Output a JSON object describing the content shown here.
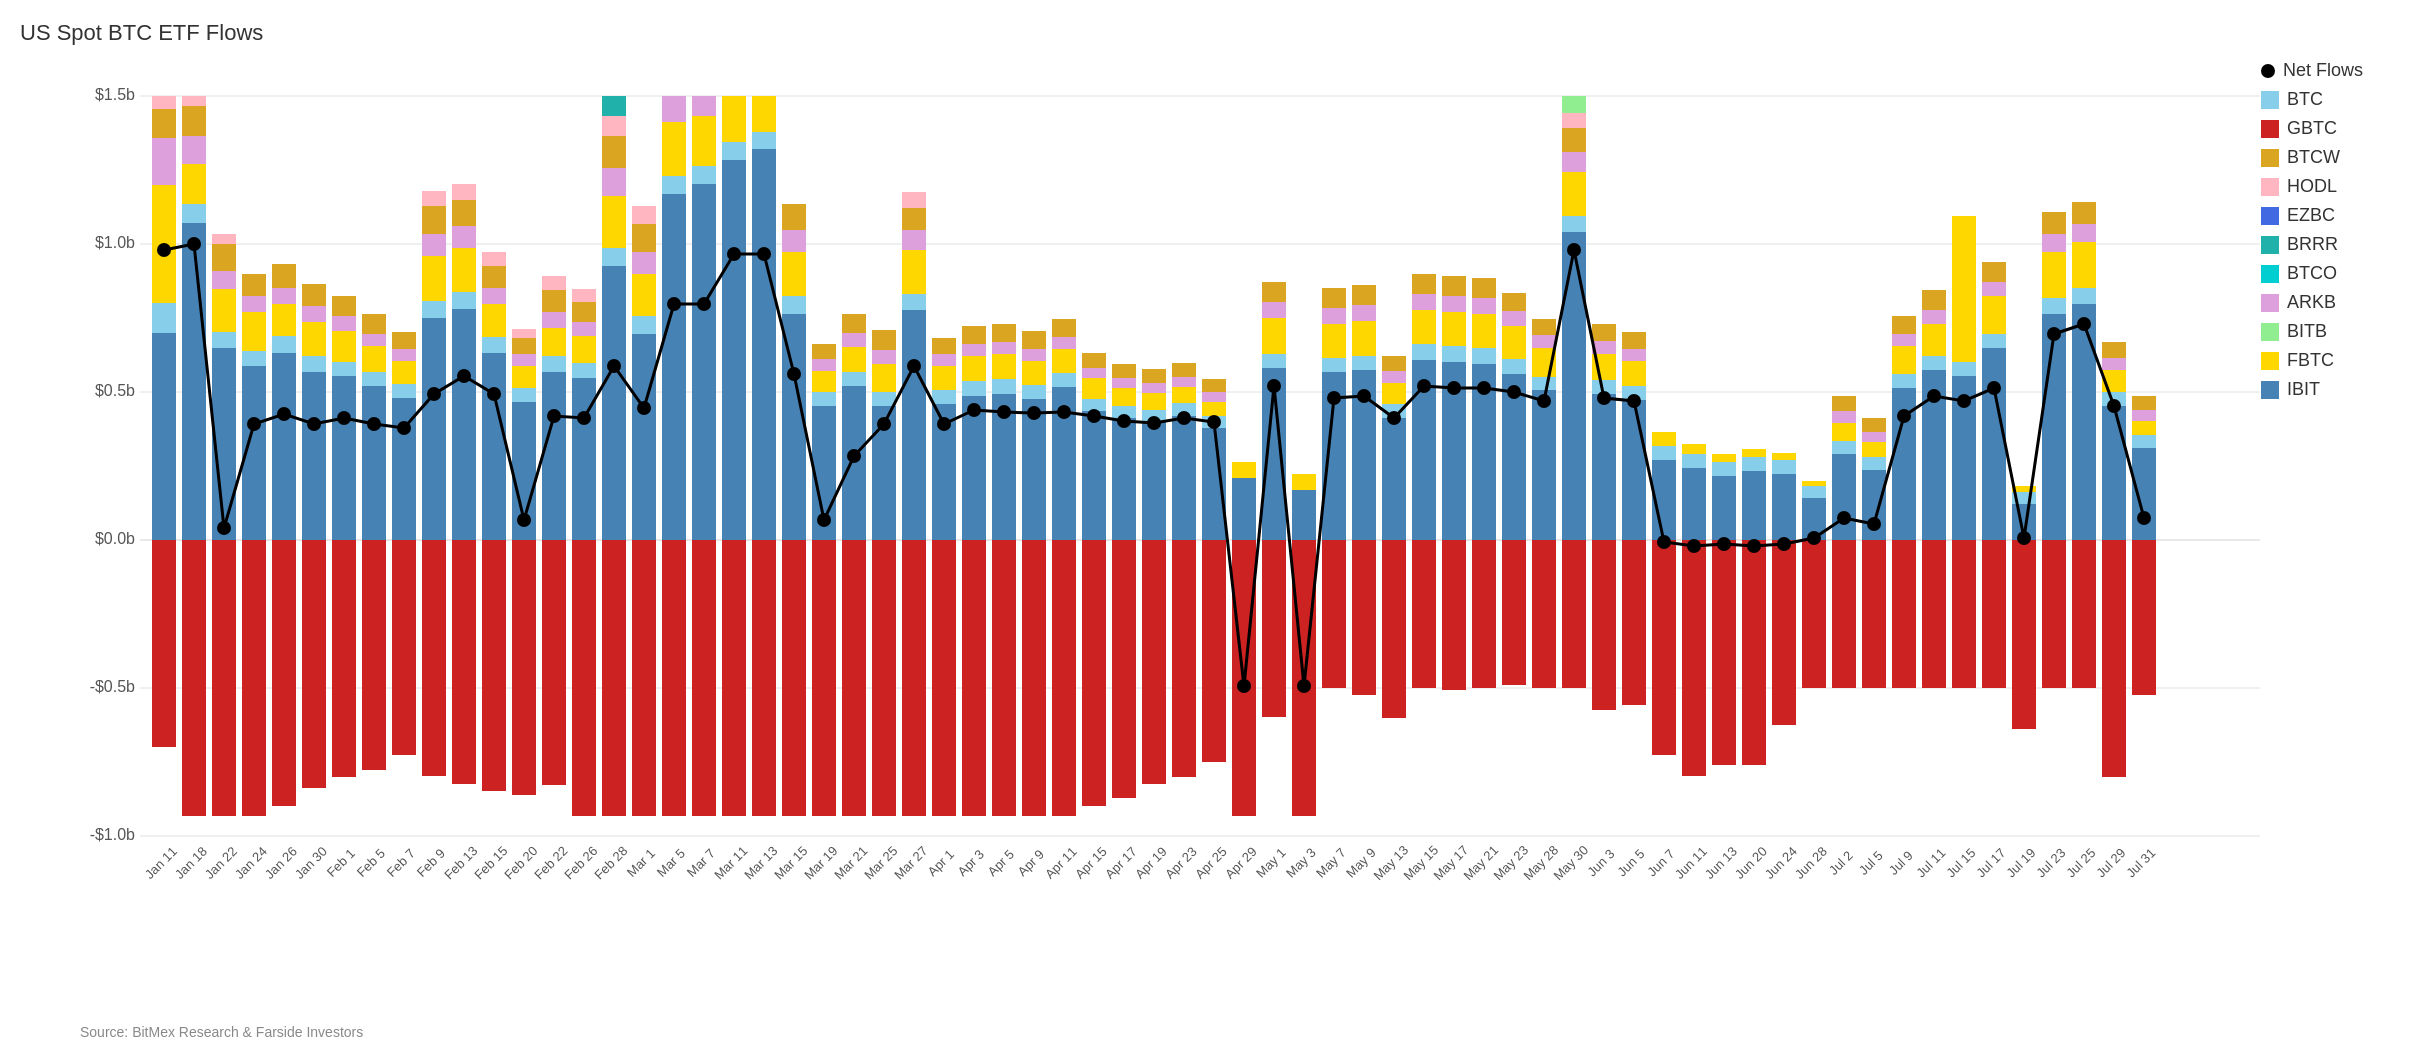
{
  "title": "US Spot BTC ETF Flows",
  "source": "Source: BitMex Research & Farside Investors",
  "yLabels": [
    "$1.5b",
    "$1.0b",
    "$0.5b",
    "$0.0b",
    "-$0.5b",
    "-$1.0b"
  ],
  "legend": {
    "items": [
      {
        "label": "Net Flows",
        "color": "#000000",
        "type": "circle"
      },
      {
        "label": "BTC",
        "color": "#87CEEB",
        "type": "square"
      },
      {
        "label": "GBTC",
        "color": "#CC2222",
        "type": "square"
      },
      {
        "label": "BTCW",
        "color": "#DAA520",
        "type": "square"
      },
      {
        "label": "HODL",
        "color": "#FFB6C1",
        "type": "square"
      },
      {
        "label": "EZBC",
        "color": "#4169E1",
        "type": "square"
      },
      {
        "label": "BRRR",
        "color": "#20B2AA",
        "type": "square"
      },
      {
        "label": "BTCO",
        "color": "#00CED1",
        "type": "square"
      },
      {
        "label": "ARKB",
        "color": "#DDA0DD",
        "type": "square"
      },
      {
        "label": "BITB",
        "color": "#90EE90",
        "type": "square"
      },
      {
        "label": "FBTC",
        "color": "#FFD700",
        "type": "square"
      },
      {
        "label": "IBIT",
        "color": "#4682B4",
        "type": "square"
      }
    ]
  },
  "xLabels": [
    "Jan 11",
    "Jan 18",
    "Jan 22",
    "Jan 24",
    "Jan 26",
    "Jan 30",
    "Feb 1",
    "Feb 5",
    "Feb 7",
    "Feb 9",
    "Feb 13",
    "Feb 15",
    "Feb 20",
    "Feb 22",
    "Feb 26",
    "Feb 28",
    "Mar 1",
    "Mar 5",
    "Mar 7",
    "Mar 11",
    "Mar 13",
    "Mar 15",
    "Mar 19",
    "Mar 21",
    "Mar 25",
    "Mar 27",
    "Apr 1",
    "Apr 3",
    "Apr 5",
    "Apr 9",
    "Apr 11",
    "Apr 15",
    "Apr 17",
    "Apr 19",
    "Apr 23",
    "Apr 25",
    "Apr 29",
    "May 1",
    "May 3",
    "May 7",
    "May 9",
    "May 13",
    "May 15",
    "May 17",
    "May 21",
    "May 23",
    "May 28",
    "May 30",
    "Jun 3",
    "Jun 5",
    "Jun 7",
    "Jun 11",
    "Jun 13",
    "Jun 20",
    "Jun 24",
    "Jun 28",
    "Jul 2",
    "Jul 5",
    "Jul 9",
    "Jul 11",
    "Jul 15",
    "Jul 17",
    "Jul 19",
    "Jul 23",
    "Jul 25",
    "Jul 29",
    "Jul 31"
  ]
}
